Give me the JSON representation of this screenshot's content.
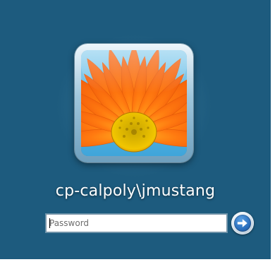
{
  "logon": {
    "username": "cp-calpoly\\jmustang",
    "password_placeholder": "Password",
    "password_value": "",
    "user_tile_image": "orange-gerbera-flower",
    "submit_icon": "arrow-right-icon"
  },
  "colors": {
    "background": "#1d5b7e",
    "text": "#ffffff",
    "button_accent": "#2a6fbd"
  }
}
